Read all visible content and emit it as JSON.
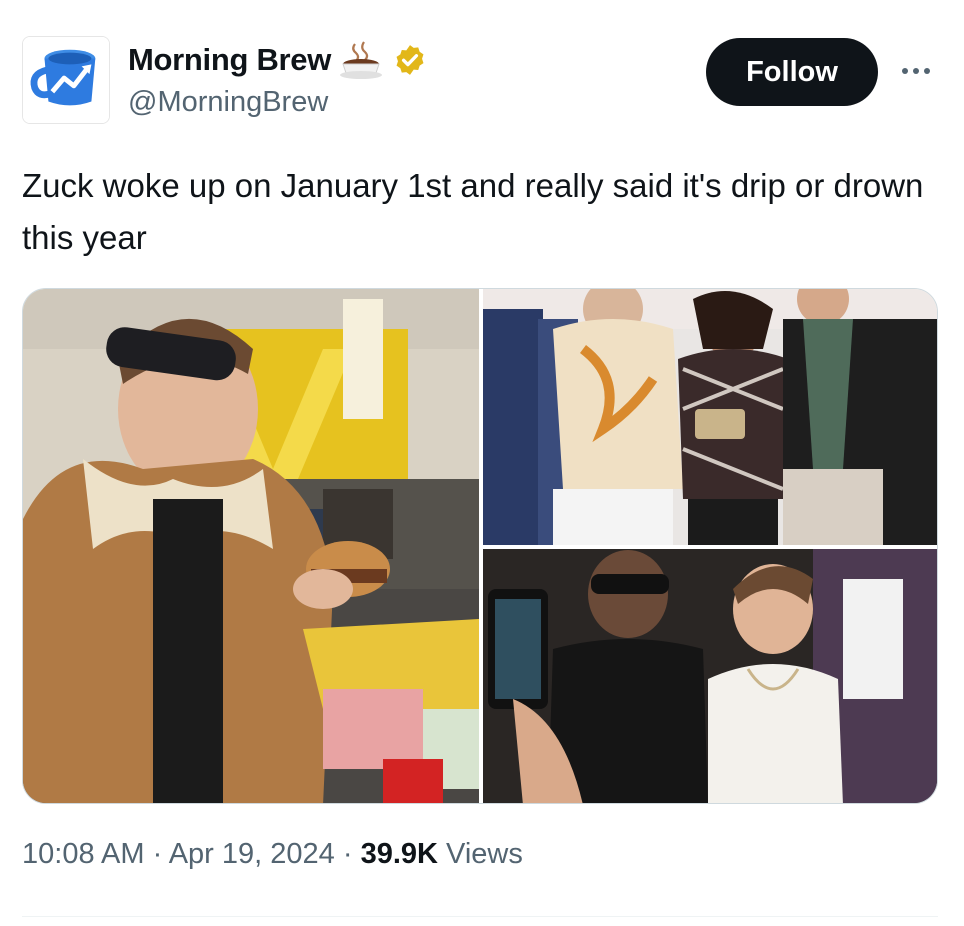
{
  "account": {
    "display_name": "Morning Brew",
    "handle": "@MorningBrew",
    "verified": true,
    "emoji_icon": "coffee-cup-icon",
    "badge_color": "#e2b719"
  },
  "actions": {
    "follow_label": "Follow",
    "more_icon": "more-options-icon"
  },
  "tweet": {
    "text": "Zuck woke up on January 1st and really said it's drip or drown this year"
  },
  "media": {
    "photo_count": 3
  },
  "meta": {
    "time": "10:08 AM",
    "separator": " · ",
    "date": "Apr 19, 2024",
    "views_count": "39.9K",
    "views_label": "Views"
  },
  "colors": {
    "text": "#0f1419",
    "secondary": "#536471",
    "follow_bg": "#0f1419",
    "border": "#cfd9de",
    "avatar_blue": "#1d6fd0"
  }
}
